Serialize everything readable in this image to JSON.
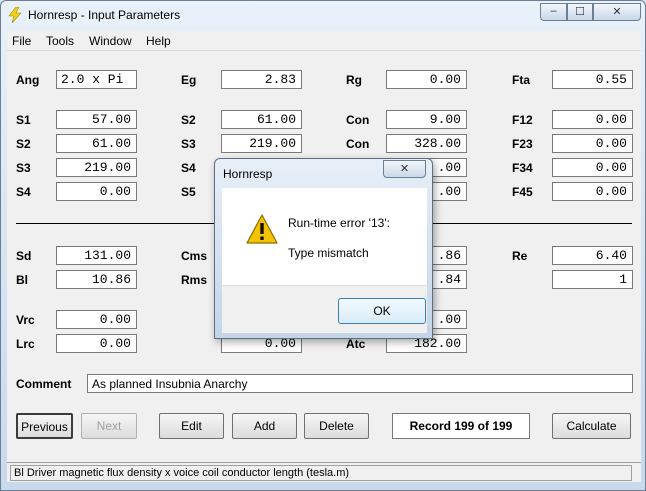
{
  "window": {
    "title": "Hornresp - Input Parameters",
    "controls": {
      "minimize": "–",
      "maximize": "☐",
      "close": "✕"
    }
  },
  "menu": [
    "File",
    "Tools",
    "Window",
    "Help"
  ],
  "params": {
    "row1": [
      {
        "label": "Ang",
        "value": "2.0 x Pi"
      },
      {
        "label": "Eg",
        "value": "2.83"
      },
      {
        "label": "Rg",
        "value": "0.00"
      },
      {
        "label": "Fta",
        "value": "0.55"
      }
    ],
    "horn": [
      [
        {
          "label": "S1",
          "value": "57.00"
        },
        {
          "label": "S2",
          "value": "61.00"
        },
        {
          "label": "Con",
          "value": "9.00"
        },
        {
          "label": "F12",
          "value": "0.00"
        }
      ],
      [
        {
          "label": "S2",
          "value": "61.00"
        },
        {
          "label": "S3",
          "value": "219.00"
        },
        {
          "label": "Con",
          "value": "328.00"
        },
        {
          "label": "F23",
          "value": "0.00"
        }
      ],
      [
        {
          "label": "S3",
          "value": "219.00"
        },
        {
          "label": "S4",
          "value": ""
        },
        {
          "label": "",
          "value": ".00"
        },
        {
          "label": "F34",
          "value": "0.00"
        }
      ],
      [
        {
          "label": "S4",
          "value": "0.00"
        },
        {
          "label": "S5",
          "value": ""
        },
        {
          "label": "",
          "value": ".00"
        },
        {
          "label": "F45",
          "value": "0.00"
        }
      ]
    ],
    "driver": [
      [
        {
          "label": "Sd",
          "value": "131.00"
        },
        {
          "label": "Cms",
          "value": ""
        },
        {
          "label": "",
          "value": ".86"
        },
        {
          "label": "Re",
          "value": "6.40"
        }
      ],
      [
        {
          "label": "Bl",
          "value": "10.86"
        },
        {
          "label": "Rms",
          "value": ""
        },
        {
          "label": "",
          "value": ".84"
        },
        {
          "label": "",
          "value": "1"
        }
      ]
    ],
    "chamber": [
      [
        {
          "label": "Vrc",
          "value": "0.00"
        },
        {
          "label": "",
          "value": ""
        },
        {
          "label": "",
          "value": ".00"
        }
      ],
      [
        {
          "label": "Lrc",
          "value": "0.00"
        },
        {
          "label": "",
          "value": "0.00"
        },
        {
          "label": "Atc",
          "value": "182.00"
        }
      ]
    ]
  },
  "comment": {
    "label": "Comment",
    "value": "As planned Insubnia Anarchy"
  },
  "buttons": {
    "previous": "Previous",
    "next": "Next",
    "edit": "Edit",
    "add": "Add",
    "delete": "Delete",
    "calculate": "Calculate"
  },
  "record": "Record 199 of 199",
  "status": "Bl   Driver magnetic flux density x voice coil conductor length  (tesla.m)",
  "dialog": {
    "title": "Hornresp",
    "close": "✕",
    "message": "Run-time error '13':",
    "detail": "Type mismatch",
    "ok": "OK"
  },
  "colors": {
    "accent": "#3c7fb1",
    "warning": "#f5c400",
    "titlebar": "#c8d9ec"
  }
}
